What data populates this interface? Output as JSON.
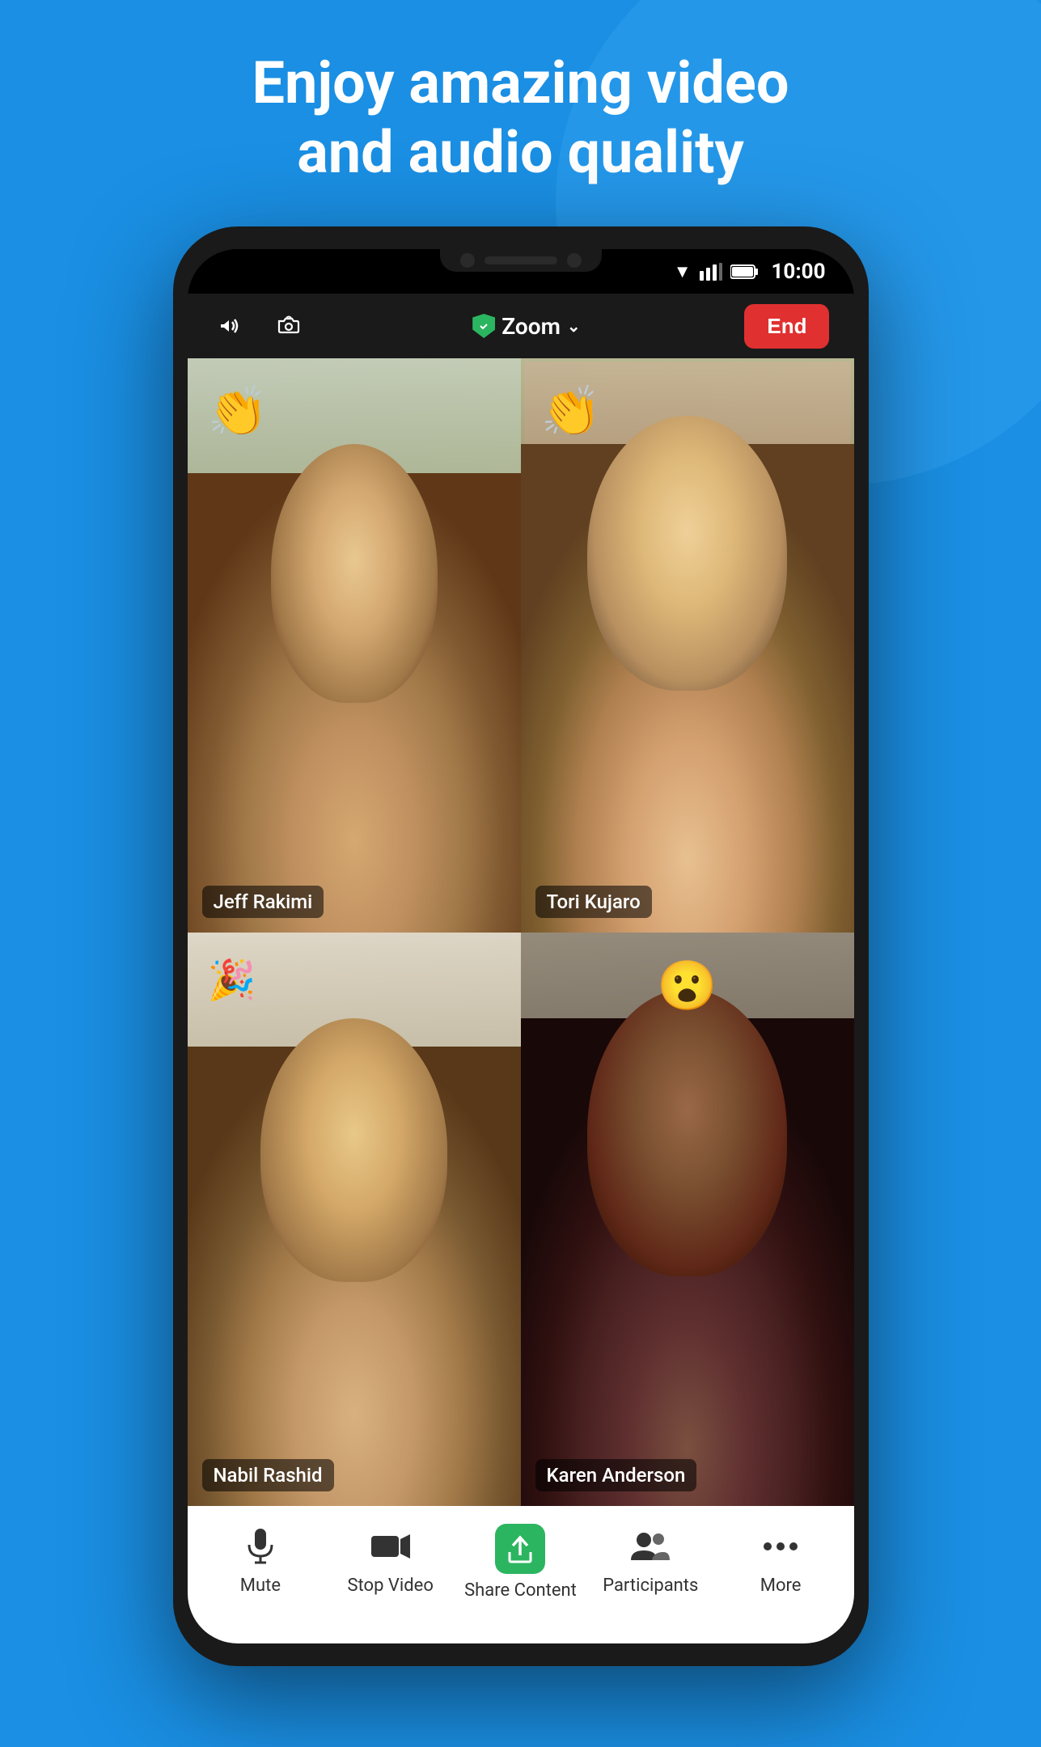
{
  "headline": {
    "line1": "Enjoy amazing video",
    "line2": "and audio quality"
  },
  "status_bar": {
    "time": "10:00"
  },
  "top_bar": {
    "zoom_label": "Zoom",
    "end_label": "End"
  },
  "participants": [
    {
      "name": "Jeff Rakimi",
      "emoji": "👏",
      "active": false,
      "position": "top-left"
    },
    {
      "name": "Tori Kujaro",
      "emoji": "👏",
      "active": true,
      "position": "top-right"
    },
    {
      "name": "Nabil Rashid",
      "emoji": "🎉",
      "active": false,
      "position": "bottom-left"
    },
    {
      "name": "Karen Anderson",
      "emoji": "😮",
      "active": false,
      "position": "bottom-right"
    }
  ],
  "toolbar": {
    "items": [
      {
        "id": "mute",
        "label": "Mute"
      },
      {
        "id": "stop-video",
        "label": "Stop Video"
      },
      {
        "id": "share-content",
        "label": "Share Content"
      },
      {
        "id": "participants",
        "label": "Participants"
      },
      {
        "id": "more",
        "label": "More"
      }
    ]
  }
}
